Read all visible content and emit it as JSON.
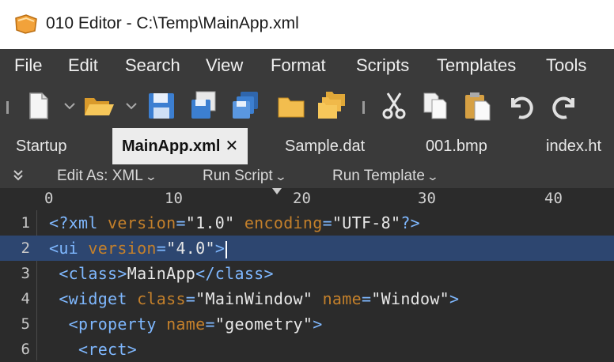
{
  "window": {
    "title": "010 Editor - C:\\Temp\\MainApp.xml"
  },
  "menu": [
    "File",
    "Edit",
    "Search",
    "View",
    "Format",
    "Scripts",
    "Templates",
    "Tools"
  ],
  "toolbar_icons": [
    "new-file-icon",
    "open-folder-icon",
    "save-icon",
    "save-as-icon",
    "save-all-icon",
    "folder-icon",
    "folders-icon",
    "cut-icon",
    "copy-icon",
    "paste-icon",
    "undo-icon",
    "redo-icon"
  ],
  "tabs": [
    {
      "label": "Startup"
    },
    {
      "label": "MainApp.xml",
      "close": "✕"
    },
    {
      "label": "Sample.dat"
    },
    {
      "label": "001.bmp"
    },
    {
      "label": "index.ht"
    }
  ],
  "subbar": {
    "edit_as": "Edit As: XML",
    "run_script": "Run Script",
    "run_template": "Run Template"
  },
  "ruler": [
    "0",
    "10",
    "20",
    "30",
    "40"
  ],
  "lines": [
    {
      "n": "1",
      "parts": [
        [
          "t",
          "<?xml "
        ],
        [
          "a",
          "version"
        ],
        [
          "t",
          "="
        ],
        [
          "s",
          "\"1.0\""
        ],
        [
          "x",
          " "
        ],
        [
          "a",
          "encoding"
        ],
        [
          "t",
          "="
        ],
        [
          "s",
          "\"UTF-8\""
        ],
        [
          "t",
          "?>"
        ]
      ]
    },
    {
      "n": "2",
      "current": true,
      "parts": [
        [
          "t",
          "<ui "
        ],
        [
          "a",
          "version"
        ],
        [
          "t",
          "="
        ],
        [
          "s",
          "\"4.0\""
        ],
        [
          "t",
          ">"
        ]
      ]
    },
    {
      "n": "3",
      "parts": [
        [
          "t",
          " <class>"
        ],
        [
          "x",
          "MainApp"
        ],
        [
          "t",
          "</class>"
        ]
      ]
    },
    {
      "n": "4",
      "parts": [
        [
          "t",
          " <widget "
        ],
        [
          "a",
          "class"
        ],
        [
          "t",
          "="
        ],
        [
          "s",
          "\"MainWindow\""
        ],
        [
          "x",
          " "
        ],
        [
          "a",
          "name"
        ],
        [
          "t",
          "="
        ],
        [
          "s",
          "\"Window\""
        ],
        [
          "t",
          ">"
        ]
      ]
    },
    {
      "n": "5",
      "parts": [
        [
          "t",
          "  <property "
        ],
        [
          "a",
          "name"
        ],
        [
          "t",
          "="
        ],
        [
          "s",
          "\"geometry\""
        ],
        [
          "t",
          ">"
        ]
      ]
    },
    {
      "n": "6",
      "parts": [
        [
          "t",
          "   <rect>"
        ]
      ]
    }
  ]
}
